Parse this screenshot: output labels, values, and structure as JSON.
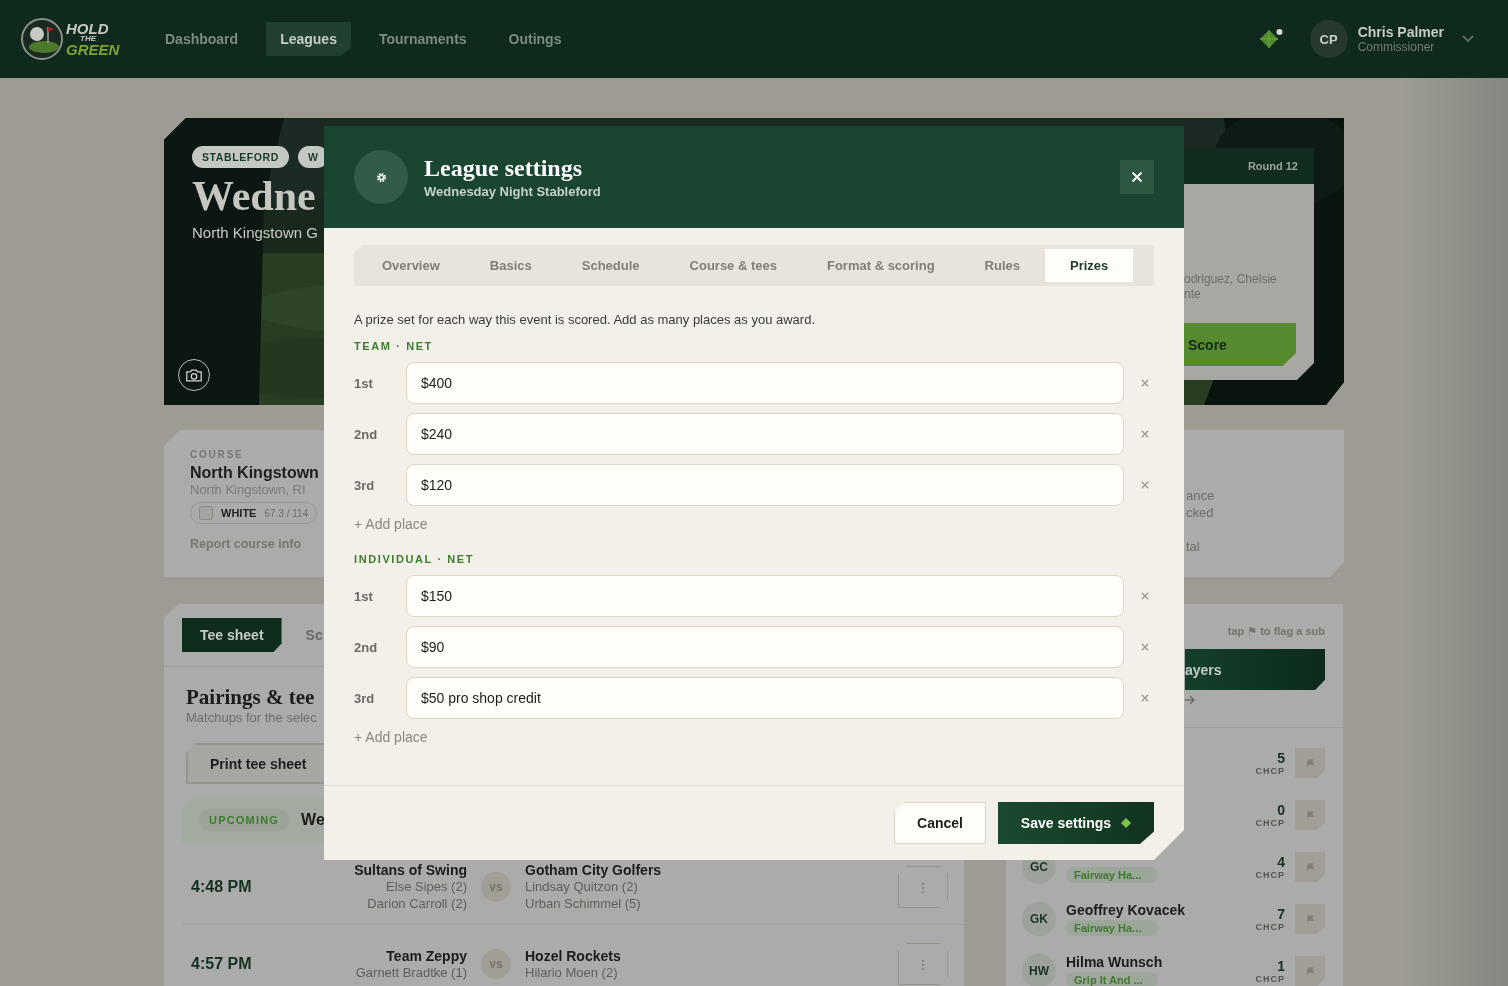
{
  "header": {
    "logo": [
      "HOLD",
      "THE",
      "GREEN"
    ],
    "nav": [
      {
        "label": "Dashboard",
        "selected": false
      },
      {
        "label": "Leagues",
        "selected": true
      },
      {
        "label": "Tournaments",
        "selected": false
      },
      {
        "label": "Outings",
        "selected": false
      }
    ],
    "user": {
      "initials": "CP",
      "name": "Chris Palmer",
      "role": "Commissioner"
    }
  },
  "hero": {
    "badges": [
      "STABLEFORD",
      "W"
    ],
    "title": "Wedne",
    "subtitle": "North Kingstown G",
    "round_card": {
      "title": "Round 12",
      "lines": [
        "odriguez, Chelsie",
        "nte"
      ],
      "button": "Score"
    }
  },
  "course": {
    "label": "COURSE",
    "name": "North Kingstown",
    "location": "North Kingstown, RI",
    "tee": {
      "name": "WHITE",
      "rating": "67.3 / 114",
      "checked": false
    },
    "link": "Report course info",
    "lines": [
      "ance",
      "cked",
      "tal"
    ]
  },
  "tee_sheet": {
    "tabs": [
      {
        "label": "Tee sheet",
        "selected": true
      },
      {
        "label": "Sc",
        "selected": false
      }
    ],
    "title": "Pairings & tee",
    "subtitle": "Matchups for the selec",
    "print_button": "Print tee sheet",
    "status": {
      "badge": "UPCOMING",
      "text": "We"
    },
    "pairings": [
      {
        "time": "4:48 PM",
        "team_1": {
          "name": "Sultans of Swing",
          "players": [
            "Else Sipes (2)",
            "Darion Carroll (2)"
          ]
        },
        "vs": "vs",
        "team_2": {
          "name": "Gotham City Golfers",
          "players": [
            "Lindsay Quitzon (2)",
            "Urban Schimmel (5)"
          ]
        },
        "menu": "⋮"
      },
      {
        "time": "4:57 PM",
        "team_1": {
          "name": "Team Zeppy",
          "players": [
            "Garnett Bradtke (1)"
          ]
        },
        "vs": "vs",
        "team_2": {
          "name": "Hozel Rockets",
          "players": [
            "Hilario Moen (2)"
          ]
        },
        "menu": "⋮"
      }
    ]
  },
  "players": {
    "hint": "tap ⚑ to flag a sub",
    "button": "ayers",
    "rows": [
      {
        "hcp": "5",
        "hcp_label": "CHCP"
      },
      {
        "hcp": "0",
        "hcp_label": "CHCP"
      },
      {
        "initials": "GC",
        "team": "Fairway Ha...",
        "hcp": "4",
        "hcp_label": "CHCP"
      },
      {
        "initials": "GK",
        "name": "Geoffrey Kovacek",
        "team": "Fairway Ha...",
        "hcp": "7",
        "hcp_label": "CHCP"
      },
      {
        "initials": "HW",
        "name": "Hilma Wunsch",
        "team": "Grip It And ...",
        "hcp": "1",
        "hcp_label": "CHCP"
      }
    ]
  },
  "modal": {
    "title": "League settings",
    "subtitle": "Wednesday Night Stableford",
    "tabs": [
      {
        "label": "Overview",
        "selected": false
      },
      {
        "label": "Basics",
        "selected": false
      },
      {
        "label": "Schedule",
        "selected": false
      },
      {
        "label": "Course & tees",
        "selected": false
      },
      {
        "label": "Format & scoring",
        "selected": false
      },
      {
        "label": "Rules",
        "selected": false
      },
      {
        "label": "Prizes",
        "selected": true
      }
    ],
    "description": "A prize set for each way this event is scored. Add as many places as you award.",
    "sections": [
      {
        "label": "TEAM · NET",
        "places": [
          {
            "place": "1st",
            "value": "$400"
          },
          {
            "place": "2nd",
            "value": "$240"
          },
          {
            "place": "3rd",
            "value": "$120"
          }
        ],
        "add_label": "+ Add place"
      },
      {
        "label": "INDIVIDUAL · NET",
        "places": [
          {
            "place": "1st",
            "value": "$150"
          },
          {
            "place": "2nd",
            "value": "$90"
          },
          {
            "place": "3rd",
            "value": "$50 pro shop credit"
          }
        ],
        "add_label": "+ Add place"
      }
    ],
    "cancel": "Cancel",
    "save": "Save settings"
  }
}
